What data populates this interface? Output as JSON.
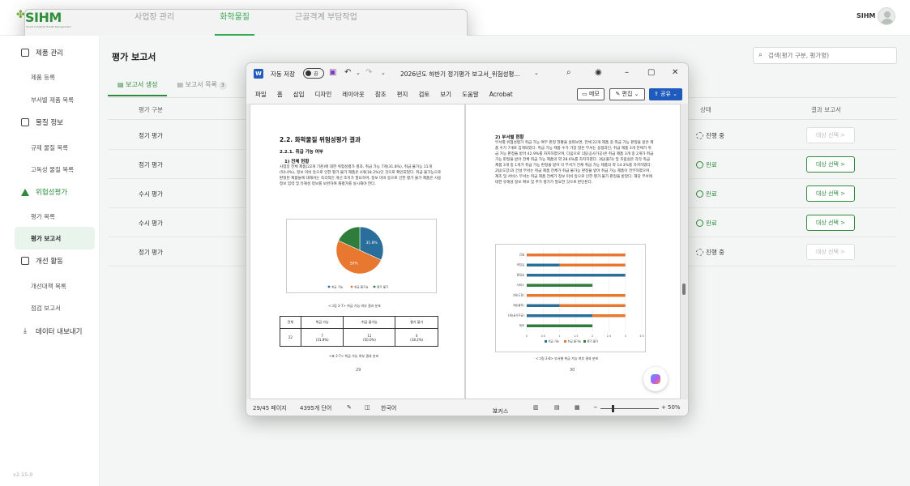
{
  "app": {
    "logo": "SIHM",
    "logo_tagline": "Smart Industrial Health Management",
    "nav": [
      "사업장 관리",
      "화학물질",
      "근골격계 부담작업"
    ],
    "nav_active_index": 1,
    "user": "SIHM",
    "version": "v2.15.0",
    "colors": {
      "accent": "#34a853",
      "accent_dark": "#2e8b3e"
    }
  },
  "sidebar": {
    "groups": [
      {
        "label": "제품 관리",
        "icon": "document-icon",
        "items": [
          "제품 등록",
          "부서별 제품 목록"
        ]
      },
      {
        "label": "물질 정보",
        "icon": "search-doc-icon",
        "items": [
          "규제 물질 목록",
          "고독성 물질 목록"
        ]
      },
      {
        "label": "위험성평가",
        "icon": "warning-icon",
        "items": [
          "평가 목록",
          "평가 보고서"
        ]
      },
      {
        "label": "개선 활동",
        "icon": "clipboard-icon",
        "items": [
          "개선대책 목록",
          "점검 보고서"
        ]
      },
      {
        "label": "데이터 내보내기",
        "icon": "download-icon",
        "items": []
      }
    ],
    "active_item": "평가 보고서"
  },
  "main": {
    "title": "평가 보고서",
    "search_placeholder": "검색(평가 구분, 평가명)",
    "tabs": [
      {
        "label": "보고서 생성",
        "icon": "report-icon"
      },
      {
        "label": "보고서 목록",
        "icon": "list-icon",
        "badge": "3"
      }
    ],
    "table": {
      "headers": [
        "평가 구분",
        "상태",
        "결과 보고서"
      ],
      "rows": [
        {
          "type": "정기 평가",
          "status": "진행 중",
          "done": false,
          "button": "대상 선택 >"
        },
        {
          "type": "정기 평가",
          "status": "완료",
          "done": true,
          "button": "대상 선택 >"
        },
        {
          "type": "수시 평가",
          "status": "완료",
          "done": true,
          "button": "대상 선택 >"
        },
        {
          "type": "수시 평가",
          "status": "완료",
          "done": true,
          "button": "대상 선택 >"
        },
        {
          "type": "정기 평가",
          "status": "진행 중",
          "done": false,
          "button": "대상 선택 >"
        }
      ]
    }
  },
  "word": {
    "autosave_label": "자동 저장",
    "autosave_state": "끔",
    "doc_title": "2026년도 하반기 정기평가 보고서_위험성평...",
    "menu": [
      "파일",
      "홈",
      "삽입",
      "디자인",
      "레이아웃",
      "참조",
      "편지",
      "검토",
      "보기",
      "도움말",
      "Acrobat"
    ],
    "memo": "메모",
    "edit": "편집",
    "share": "공유",
    "status": {
      "page": "29/45 페이지",
      "words": "4395개 단어",
      "lang": "한국어",
      "focus": "포커스",
      "zoom": "50%"
    },
    "page1": {
      "heading": "2.2. 화학물질 위험성평가 결과",
      "sub": "2.2.1. 취급 가능 여부",
      "sub2": "1) 전체 현황",
      "para": "사업장 전체 제품(22개 기준)에 대한 위험성평가 결과, 취급 가능 7개(31.8%), 취급 불가능 11개(50.0%), 정보 미비 등으로 인한 평가 불가 제품은 4개(18.2%)인 것으로 확인되었다. 취급 불가능으로 판정된 제품들에 대해서는 즉각적인 개선 조치가 필요하며, 정보 미비 등으로 인한 평가 불가 제품은 사용 정보 입력 및 유해성 정보를 보완하여 재평가를 실시해야 한다.",
      "fig_caption": "<그림 2-7> 취급 가능 여부 결과 분포",
      "table_caption": "<표 2-7> 취급 가능 여부 결과 분포",
      "table_headers": [
        "전체",
        "취급 가능",
        "취급 불가능",
        "평가 불가"
      ],
      "table_values": [
        "22",
        "7",
        "11",
        "4"
      ],
      "table_pcts": [
        "",
        "(31.8%)",
        "(50.0%)",
        "(18.2%)"
      ],
      "page_no": "29"
    },
    "page2": {
      "heading": "2) 부서별 현황",
      "para": "부서별 위험성평가 취급 가능 여부 판정 현황을 살펴보면, 전체 22개 제품 중 취급 가능 판정을 받은 제품 수가 7개로 집계되었다. 취급 가능 제품 수가 가장 많은 부서는 용접라인, 취급 제품 3개 전체가 취급 가능 판정을 받아 42.9%를 차지하였으며, 다음으로 1팀(공사가공)은 취급 제품 3개 중 2개가 취급 가능 판정을 받아 전체 취급 가능 제품의 약 28.6%를 차지하였다. 3팀(출하) 및 조립실은 각각 취급 제품 3개 중 1개가 취급 가능 판정을 받아 각 부서가 전체 취급 가능 제품의 약 14.3%를 차지하였다. 2팀(도장)과 건설 부서는 취급 제품 전체가 취급 불가능 판정을 받아 취급 가능 제품이 전무하였으며, 제조 및 서비스 부서는 취급 제품 전체가 정보 미비 등으로 인한 평가 불가 판정을 받았다. 해당 부서에 대한 유해성 정보 확보 및 추가 평가가 필요한 것으로 판단된다.",
      "fig_caption": "<그림 2-8> 부서별 취급 가능 여부 결과 분포",
      "page_no": "30"
    }
  },
  "chart_data": [
    {
      "type": "pie",
      "title": "",
      "series": [
        {
          "name": "취급 가능",
          "value": 31.8,
          "color": "#2a6f9b"
        },
        {
          "name": "취급 불가능",
          "value": 50.0,
          "color": "#e8782f"
        },
        {
          "name": "평가 불가",
          "value": 18.2,
          "color": "#2f7d3a"
        }
      ],
      "data_labels": [
        "31.8%",
        "50%",
        ""
      ],
      "legend": "bottom"
    },
    {
      "type": "bar",
      "orientation": "horizontal",
      "stacked": true,
      "categories": [
        "건설",
        "조립실",
        "용접실",
        "서비스",
        "2팀(도장)",
        "3팀(출하)",
        "1팀(공사가공)",
        "제조"
      ],
      "series": [
        {
          "name": "취급 가능",
          "color": "#2a6f9b",
          "values": [
            0,
            1,
            3,
            0,
            0,
            1,
            2,
            0
          ]
        },
        {
          "name": "취급 불가능",
          "color": "#e8782f",
          "values": [
            3,
            2,
            0,
            0,
            3,
            2,
            1,
            0
          ]
        },
        {
          "name": "평가 불가",
          "color": "#2f7d3a",
          "values": [
            0,
            0,
            0,
            2,
            0,
            0,
            0,
            2
          ]
        }
      ],
      "xticks": [
        "0",
        "0.5",
        "1",
        "1.5",
        "2",
        "2.5",
        "3",
        "3.5"
      ],
      "xlim": [
        0,
        3.5
      ],
      "legend": "bottom"
    }
  ]
}
